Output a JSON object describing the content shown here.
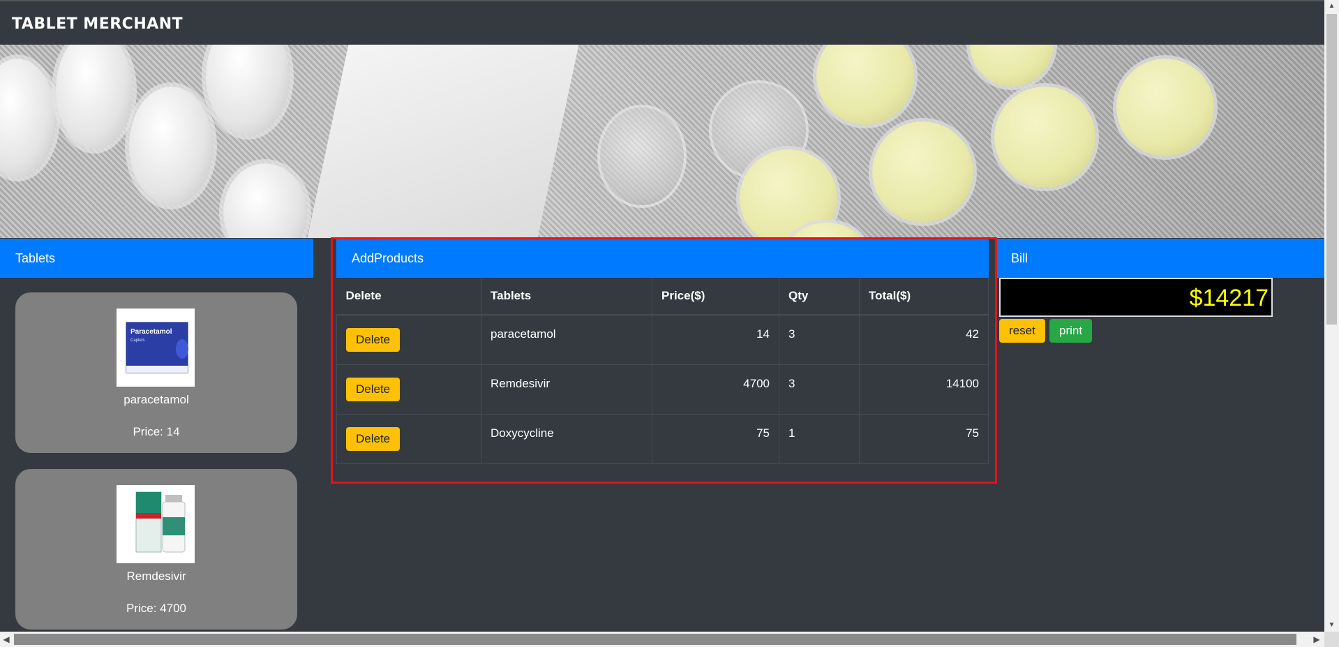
{
  "app": {
    "brand": "TABLET MERCHANT"
  },
  "panels": {
    "tablets": "Tablets",
    "add_products": "AddProducts",
    "bill": "Bill"
  },
  "products": [
    {
      "name": "paracetamol",
      "price_label": "Price: 14",
      "image": "paracetamol-box"
    },
    {
      "name": "Remdesivir",
      "price_label": "Price: 4700",
      "image": "remdesivir-vial"
    }
  ],
  "cart": {
    "headers": [
      "Delete",
      "Tablets",
      "Price($)",
      "Qty",
      "Total($)"
    ],
    "rows": [
      {
        "action": "Delete",
        "tablet": "paracetamol",
        "price": "14",
        "qty": "3",
        "total": "42"
      },
      {
        "action": "Delete",
        "tablet": "Remdesivir",
        "price": "4700",
        "qty": "3",
        "total": "14100"
      },
      {
        "action": "Delete",
        "tablet": "Doxycycline",
        "price": "75",
        "qty": "1",
        "total": "75"
      }
    ]
  },
  "bill": {
    "total": "$14217",
    "reset_label": "reset",
    "print_label": "print"
  },
  "colors": {
    "accent": "#007bff",
    "background": "#343a40",
    "warning": "#ffc107",
    "success": "#28a745",
    "highlight": "#e0141e",
    "total_text": "#ffff00"
  }
}
